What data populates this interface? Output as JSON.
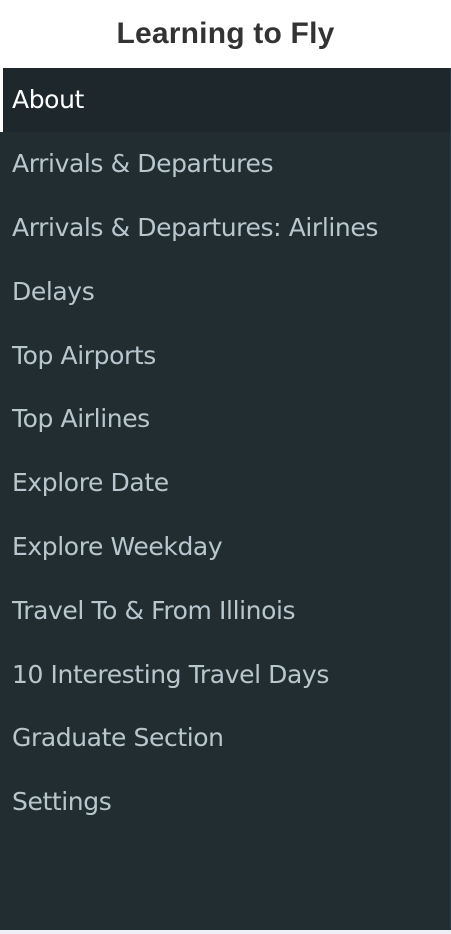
{
  "header": {
    "title": "Learning to Fly"
  },
  "sidebar": {
    "items": [
      {
        "label": "About",
        "active": true
      },
      {
        "label": "Arrivals & Departures",
        "active": false
      },
      {
        "label": "Arrivals & Departures: Airlines",
        "active": false
      },
      {
        "label": "Delays",
        "active": false
      },
      {
        "label": "Top Airports",
        "active": false
      },
      {
        "label": "Top Airlines",
        "active": false
      },
      {
        "label": "Explore Date",
        "active": false
      },
      {
        "label": "Explore Weekday",
        "active": false
      },
      {
        "label": "Travel To & From Illinois",
        "active": false
      },
      {
        "label": "10 Interesting Travel Days",
        "active": false
      },
      {
        "label": "Graduate Section",
        "active": false
      },
      {
        "label": "Settings",
        "active": false
      }
    ]
  },
  "colors": {
    "sidebar_bg": "#222d32",
    "active_bg": "#1e282c",
    "item_text": "#b8c7ce",
    "active_text": "#ffffff",
    "header_bg": "#ffffff",
    "title_text": "#333333"
  }
}
